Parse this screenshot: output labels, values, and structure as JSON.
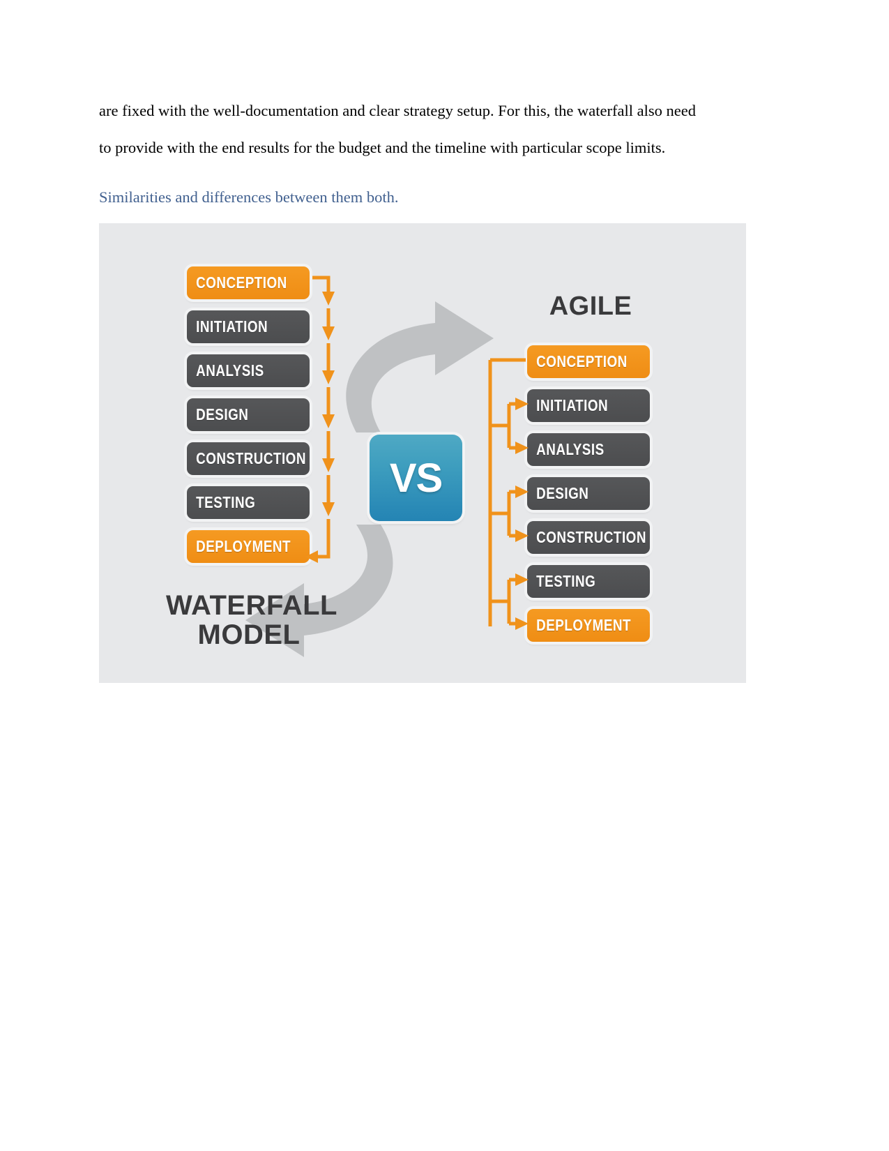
{
  "document": {
    "paragraph_lines": [
      "are fixed with the well-documentation and clear strategy setup. For this, the waterfall also need",
      "to provide with the end results for the budget and the timeline with particular scope limits."
    ],
    "heading": "Similarities and differences between them both."
  },
  "figure": {
    "background_color": "#e7e8ea",
    "vs_badge": {
      "label": "VS",
      "gradient_top": "#4fa9c4",
      "gradient_bottom": "#2484b4"
    },
    "waterfall": {
      "title_line1": "WATERFALL",
      "title_line2": "MODEL",
      "accent_color": "#f0921b",
      "dark_color": "#4f5052",
      "stages": [
        {
          "label": "CONCEPTION",
          "style": "orange"
        },
        {
          "label": "INITIATION",
          "style": "dark"
        },
        {
          "label": "ANALYSIS",
          "style": "dark"
        },
        {
          "label": "DESIGN",
          "style": "dark"
        },
        {
          "label": "CONSTRUCTION",
          "style": "dark"
        },
        {
          "label": "TESTING",
          "style": "dark"
        },
        {
          "label": "DEPLOYMENT",
          "style": "orange"
        }
      ]
    },
    "agile": {
      "title": "AGILE",
      "accent_color": "#f0921b",
      "dark_color": "#4f5052",
      "stages": [
        {
          "label": "CONCEPTION",
          "style": "orange"
        },
        {
          "label": "INITIATION",
          "style": "dark"
        },
        {
          "label": "ANALYSIS",
          "style": "dark"
        },
        {
          "label": "DESIGN",
          "style": "dark"
        },
        {
          "label": "CONSTRUCTION",
          "style": "dark"
        },
        {
          "label": "TESTING",
          "style": "dark"
        },
        {
          "label": "DEPLOYMENT",
          "style": "orange"
        }
      ]
    },
    "cycle_arrows": {
      "color": "#bfc1c3",
      "top_direction": "right",
      "bottom_direction": "left"
    }
  }
}
